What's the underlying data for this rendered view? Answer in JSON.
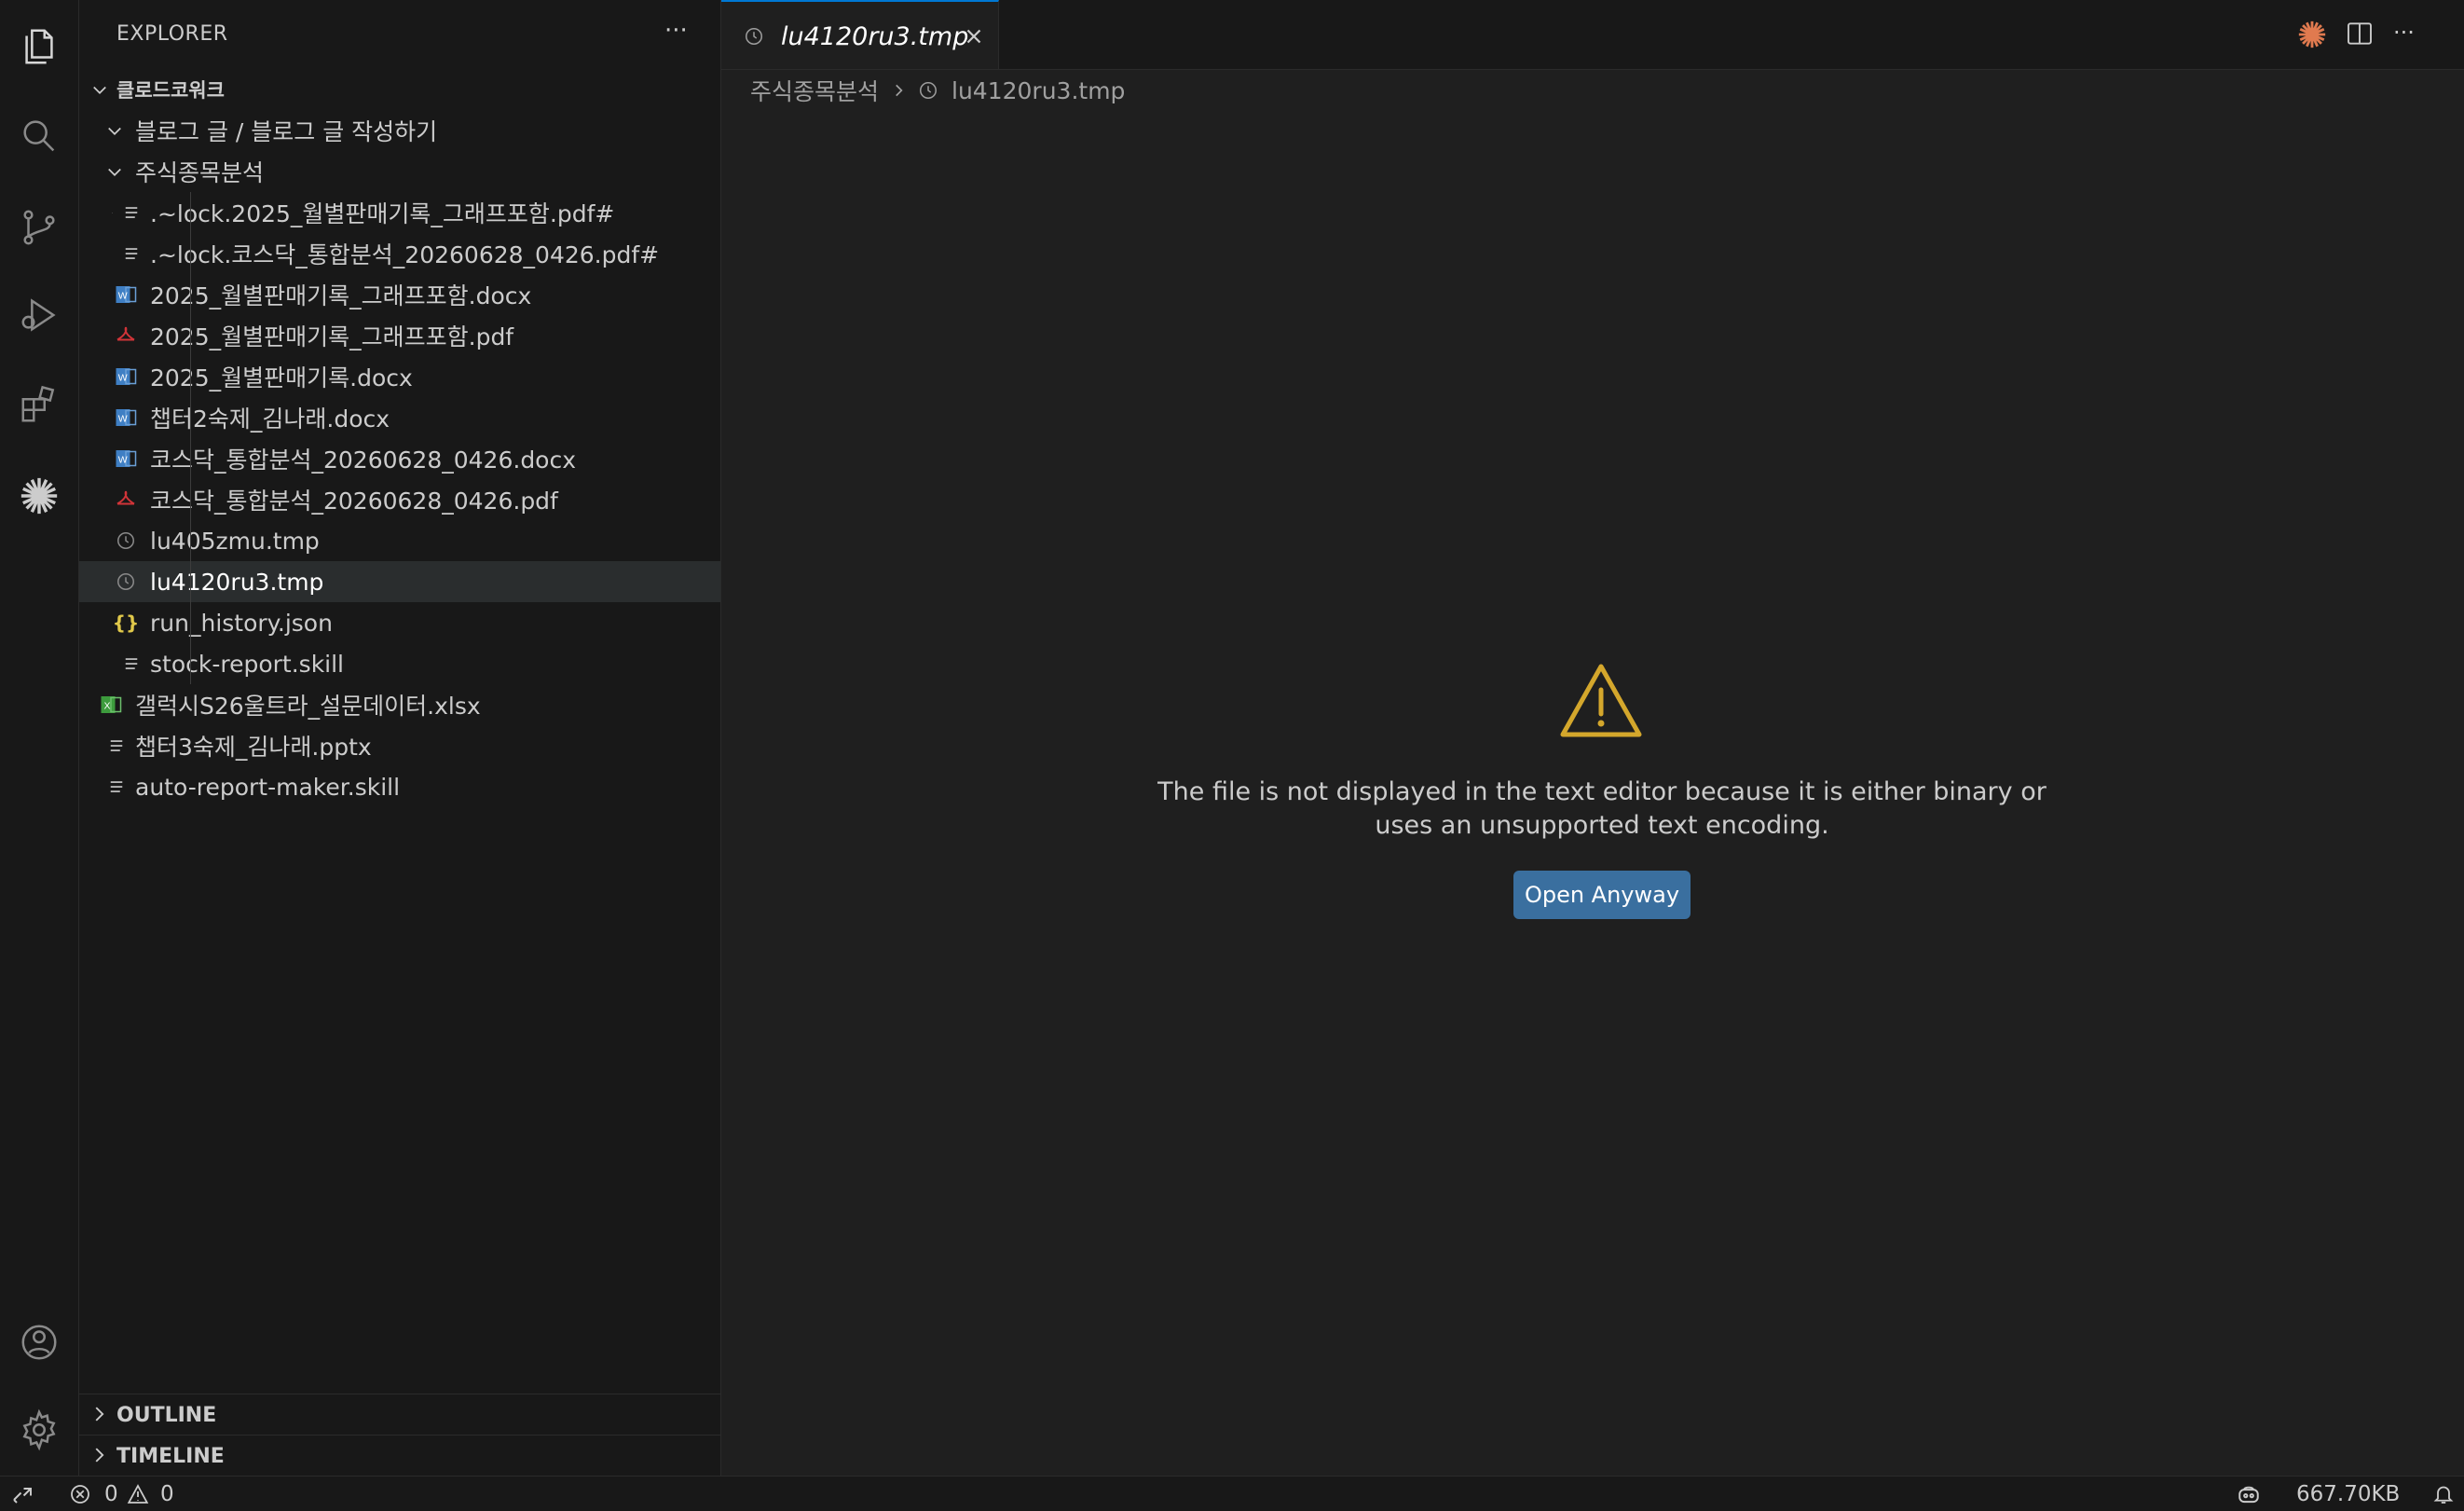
{
  "activity_bar": {
    "icons": [
      "files-icon",
      "search-icon",
      "source-control-icon",
      "run-debug-icon",
      "extensions-icon",
      "claude-icon",
      "account-icon",
      "settings-icon"
    ]
  },
  "explorer": {
    "title": "EXPLORER",
    "more": "···",
    "root": "클로드코워크",
    "items": [
      {
        "label": "블로그 글 / 블로그 글 작성하기",
        "type": "folder"
      },
      {
        "label": "주식종목분석",
        "type": "folder"
      },
      {
        "label": ".~lock.2025_월별판매기록_그래프포함.pdf#",
        "type": "text"
      },
      {
        "label": ".~lock.코스닥_통합분석_20260628_0426.pdf#",
        "type": "text"
      },
      {
        "label": "2025_월별판매기록_그래프포함.docx",
        "type": "word"
      },
      {
        "label": "2025_월별판매기록_그래프포함.pdf",
        "type": "pdf"
      },
      {
        "label": "2025_월별판매기록.docx",
        "type": "word"
      },
      {
        "label": "챕터2숙제_김나래.docx",
        "type": "word"
      },
      {
        "label": "코스닥_통합분석_20260628_0426.docx",
        "type": "word"
      },
      {
        "label": "코스닥_통합분석_20260628_0426.pdf",
        "type": "pdf"
      },
      {
        "label": "lu405zmu.tmp",
        "type": "tmp"
      },
      {
        "label": "lu4120ru3.tmp",
        "type": "tmp"
      },
      {
        "label": "run_history.json",
        "type": "json"
      },
      {
        "label": "stock-report.skill",
        "type": "text"
      },
      {
        "label": "갤럭시S26울트라_설문데이터.xlsx",
        "type": "excel"
      },
      {
        "label": "챕터3숙제_김나래.pptx",
        "type": "text"
      },
      {
        "label": "auto-report-maker.skill",
        "type": "text"
      }
    ],
    "sections": [
      "OUTLINE",
      "TIMELINE"
    ]
  },
  "editor": {
    "tab_label": "lu4120ru3.tmp",
    "breadcrumb": [
      "주식종목분석",
      "lu4120ru3.tmp"
    ],
    "message_line1": "The file is not displayed in the text editor because it is either binary or",
    "message_line2": "uses an unsupported text encoding.",
    "open_button": "Open Anyway"
  },
  "status_bar": {
    "errors": "0",
    "warnings": "0",
    "file_size": "667.70KB"
  },
  "colors": {
    "accent": "#0078d4",
    "button": "#3a6f9f",
    "warning": "#d4a72c",
    "claude": "#e07a4f",
    "pdf": "#d13438",
    "word": "#3f7fc4",
    "excel": "#3d9b3d",
    "json": "#e0c84a"
  }
}
